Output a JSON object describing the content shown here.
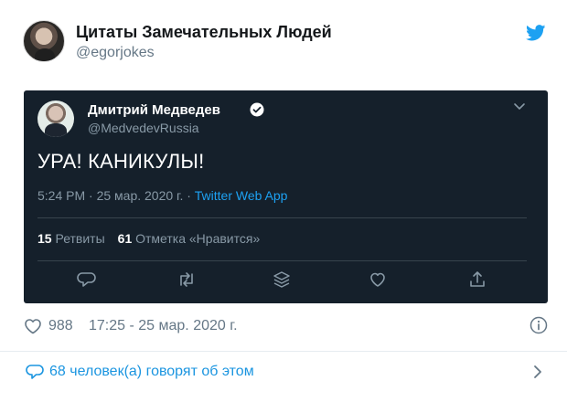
{
  "author": {
    "name": "Цитаты Замечательных Людей",
    "handle": "@egorjokes"
  },
  "quoted_tweet": {
    "name": "Дмитрий Медведев",
    "handle": "@MedvedevRussia",
    "text": "УРА! КАНИКУЛЫ!",
    "time": "5:24 PM · 25 мар. 2020 г. · ",
    "source": "Twitter Web App",
    "retweets_count": "15",
    "retweets_label": " Ретвиты",
    "likes_count": "61",
    "likes_label": " Отметка «Нравится»"
  },
  "footer": {
    "like_count": "988",
    "timestamp": "17:25 - 25 мар. 2020 г.",
    "replies_text": "68 человек(а) говорят об этом"
  },
  "colors": {
    "twitter_blue": "#1da1f2",
    "dark_bg": "#15202b",
    "muted": "#657786"
  },
  "icons": [
    "twitter-logo-icon",
    "verified-badge-icon",
    "chevron-down-icon",
    "reply-icon",
    "retweet-icon",
    "share-layers-icon",
    "like-icon",
    "share-icon",
    "heart-icon",
    "info-icon",
    "comment-icon",
    "chevron-right-icon"
  ]
}
